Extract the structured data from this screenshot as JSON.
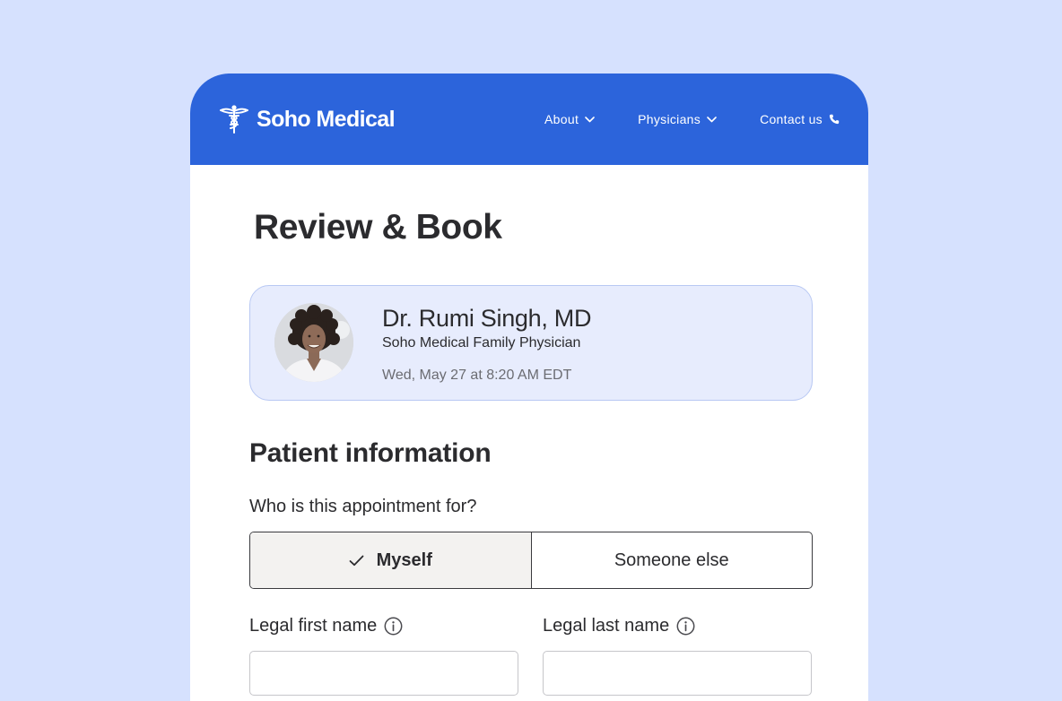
{
  "header": {
    "brand_name": "Soho Medical",
    "brand_icon": "caduceus-icon",
    "background_color": "#2c64db",
    "nav": {
      "about_label": "About",
      "physicians_label": "Physicians",
      "contact_label": "Contact us"
    }
  },
  "page": {
    "title": "Review & Book",
    "background_color": "#d6e1fe"
  },
  "appointment": {
    "doctor_name": "Dr. Rumi Singh, MD",
    "doctor_role": "Soho Medical Family Physician",
    "datetime": "Wed, May 27 at 8:20 AM EDT",
    "card_color": "#e7ecfd"
  },
  "patient_info": {
    "section_title": "Patient information",
    "question": "Who is this appointment for?",
    "options": {
      "myself_label": "Myself",
      "someone_else_label": "Someone else"
    },
    "selected_option": "Myself",
    "first_name_label": "Legal first name",
    "last_name_label": "Legal last name",
    "first_name_value": "",
    "last_name_value": ""
  }
}
